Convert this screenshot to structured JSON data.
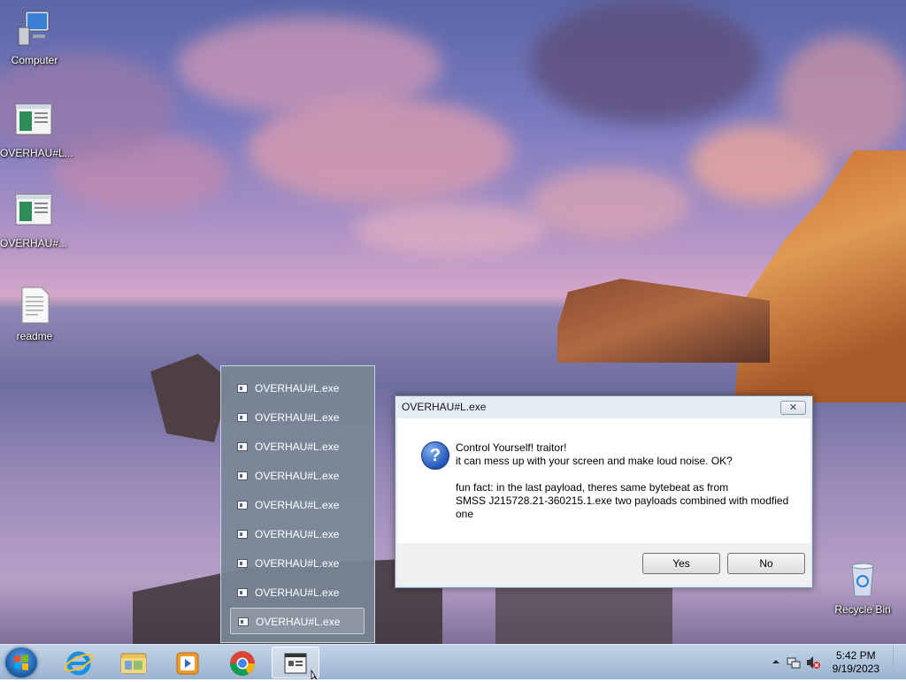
{
  "desktop": {
    "icons": [
      {
        "label": "Computer"
      },
      {
        "label": "OVERHAU#L..."
      },
      {
        "label": "OVERHAU#..."
      },
      {
        "label": "readme"
      },
      {
        "label": "Recycle Bin"
      }
    ]
  },
  "jumplist": {
    "items": [
      {
        "label": "OVERHAU#L.exe"
      },
      {
        "label": "OVERHAU#L.exe"
      },
      {
        "label": "OVERHAU#L.exe"
      },
      {
        "label": "OVERHAU#L.exe"
      },
      {
        "label": "OVERHAU#L.exe"
      },
      {
        "label": "OVERHAU#L.exe"
      },
      {
        "label": "OVERHAU#L.exe"
      },
      {
        "label": "OVERHAU#L.exe"
      },
      {
        "label": "OVERHAU#L.exe"
      }
    ]
  },
  "dialog": {
    "title": "OVERHAU#L.exe",
    "close_glyph": "✕",
    "icon_glyph": "?",
    "line1": "Control Yourself! traitor!",
    "line2": "it can mess up with your screen and make loud noise. OK?",
    "line3": "fun fact: in the last payload, theres same bytebeat as from",
    "line4": "SMSS J215728.21-360215.1.exe two payloads combined with modfied",
    "line5": "one",
    "yes_label": "Yes",
    "no_label": "No"
  },
  "taskbar": {
    "apps": [
      "start-button",
      "internet-explorer-icon",
      "file-explorer-icon",
      "media-player-icon",
      "chrome-icon",
      "overhaul-app-icon"
    ]
  },
  "tray": {
    "time": "5:42 PM",
    "date": "9/19/2023"
  }
}
